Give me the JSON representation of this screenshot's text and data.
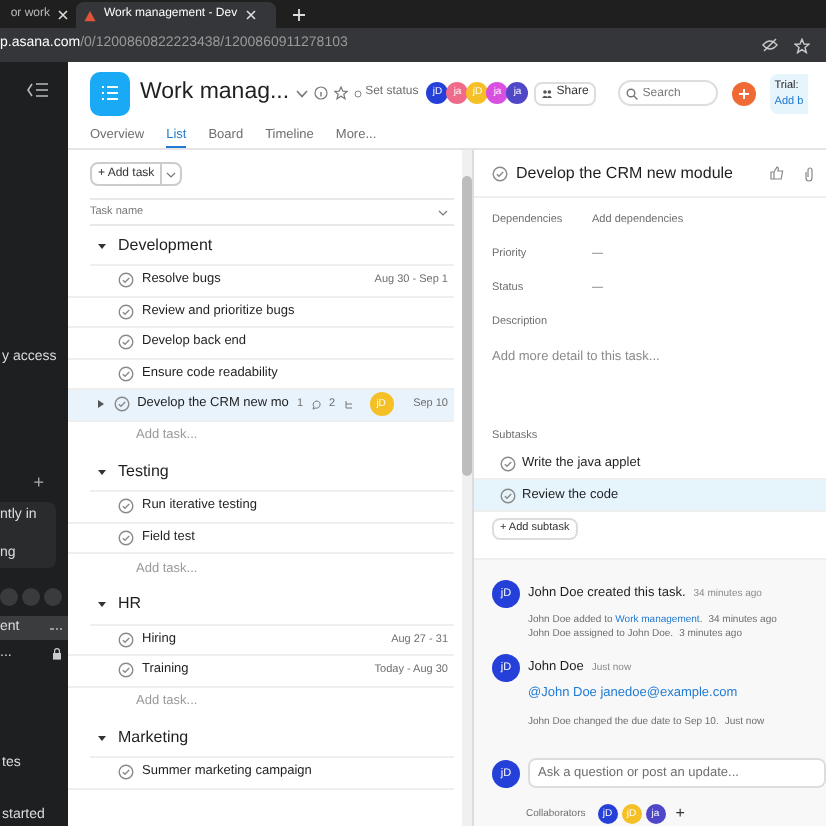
{
  "browser": {
    "tabs": [
      {
        "title": "or work",
        "selected": false
      },
      {
        "title": "Work management - Dev",
        "selected": true
      }
    ],
    "url_host": "p.asana.com",
    "url_path": "/0/1200860822223438/1200860911278103"
  },
  "sidebar": {
    "items": [
      {
        "kind": "text",
        "text": "y access"
      },
      {
        "kind": "add",
        "text": "+"
      },
      {
        "kind": "box",
        "lines": [
          "ntly in",
          "ng"
        ]
      },
      {
        "kind": "avatars"
      },
      {
        "kind": "row",
        "text": "ent",
        "selected": true
      },
      {
        "kind": "row",
        "text": "...",
        "selected": false,
        "locked": true
      },
      {
        "kind": "text",
        "text": "tes"
      },
      {
        "kind": "text",
        "text": "started"
      }
    ]
  },
  "project": {
    "title": "Work manag...",
    "status": "Set status",
    "members": [
      {
        "initials": "jD",
        "color": "#2440d8"
      },
      {
        "initials": "ja",
        "color": "#f06a8a"
      },
      {
        "initials": "jD",
        "color": "#f4c025"
      },
      {
        "initials": "ja",
        "color": "#d94fe0"
      },
      {
        "initials": "ja",
        "color": "#4f46c8"
      }
    ],
    "share": "Share",
    "search": {
      "placeholder": "Search"
    },
    "trial": "Trial:",
    "trial_link": "Add b"
  },
  "tabs": [
    {
      "label": "Overview",
      "selected": false
    },
    {
      "label": "List",
      "selected": true
    },
    {
      "label": "Board",
      "selected": false
    },
    {
      "label": "Timeline",
      "selected": false
    },
    {
      "label": "More...",
      "selected": false
    }
  ],
  "list": {
    "add_task": "+ Add task",
    "column": "Task name",
    "sections": [
      {
        "name": "Development",
        "expanded": true,
        "add_task": "Add task...",
        "tasks": [
          {
            "name": "Resolve bugs",
            "date": "Aug 30 - Sep 1",
            "selected": false
          },
          {
            "name": "Review and prioritize bugs",
            "selected": false
          },
          {
            "name": "Develop back end",
            "selected": false
          },
          {
            "name": "Ensure code readability",
            "selected": false
          },
          {
            "name": "Develop the CRM new mo",
            "selected": true,
            "has_subtasks": true,
            "comments": "1",
            "subtasks": "2",
            "assignee": {
              "initials": "jD",
              "color": "#f4c025"
            },
            "date": "Sep 10"
          }
        ]
      },
      {
        "name": "Testing",
        "expanded": true,
        "add_task": "Add task...",
        "tasks": [
          {
            "name": "Run iterative testing",
            "selected": false
          },
          {
            "name": "Field test",
            "selected": false
          }
        ]
      },
      {
        "name": "HR",
        "expanded": true,
        "add_task": "Add task...",
        "tasks": [
          {
            "name": "Hiring",
            "date": "Aug 27 - 31",
            "selected": false
          },
          {
            "name": "Training",
            "date": "Today - Aug 30",
            "selected": false
          }
        ]
      },
      {
        "name": "Marketing",
        "expanded": true,
        "tasks": [
          {
            "name": "Summer marketing campaign",
            "selected": false
          }
        ]
      }
    ]
  },
  "detail": {
    "title": "Develop the CRM new module",
    "fields": [
      {
        "label": "Dependencies",
        "value": "Add dependencies"
      },
      {
        "label": "Priority",
        "value": "—"
      },
      {
        "label": "Status",
        "value": "—"
      }
    ],
    "description_label": "Description",
    "description_placeholder": "Add more detail to this task...",
    "subtasks_label": "Subtasks",
    "subtasks": [
      {
        "name": "Write the java applet",
        "selected": false
      },
      {
        "name": "Review the code",
        "selected": true
      }
    ],
    "add_subtask": "+ Add subtask",
    "activity": [
      {
        "avatar": {
          "initials": "jD",
          "color": "#2440d8"
        },
        "author": "John Doe created this task.",
        "time": "34 minutes ago",
        "notes": [
          {
            "text": "John Doe added to ",
            "link": "Work management",
            "rest": ".",
            "time": "34 minutes ago"
          },
          {
            "text": "John Doe assigned to John Doe.",
            "time": "3 minutes ago"
          }
        ]
      },
      {
        "avatar": {
          "initials": "jD",
          "color": "#2440d8"
        },
        "author": "John Doe",
        "time": "Just now",
        "body": "@John Doe janedoe@example.com",
        "notes": [
          {
            "text": "John Doe changed the due date to Sep 10.",
            "time": "Just now"
          }
        ]
      }
    ],
    "comment": {
      "avatar": {
        "initials": "jD",
        "color": "#2440d8"
      },
      "placeholder": "Ask a question or post an update..."
    },
    "collaborators_label": "Collaborators",
    "collaborators": [
      {
        "initials": "jD",
        "color": "#2440d8"
      },
      {
        "initials": "jD",
        "color": "#f4c025"
      },
      {
        "initials": "ja",
        "color": "#4f46c8"
      }
    ],
    "add_collaborator": "+"
  }
}
